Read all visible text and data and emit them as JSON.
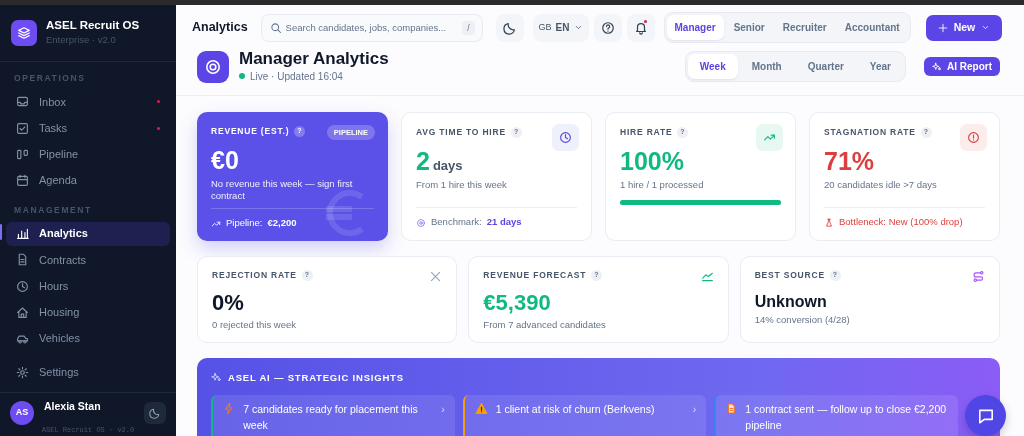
{
  "sidebar": {
    "brand": {
      "name": "ASEL Recruit OS",
      "subtitle": "Enterprise · v2.0"
    },
    "sections": [
      {
        "title": "OPERATIONS",
        "items": [
          {
            "label": "Inbox",
            "selected": false,
            "dot": true
          },
          {
            "label": "Tasks",
            "selected": false,
            "dot": true
          },
          {
            "label": "Pipeline",
            "selected": false,
            "dot": false
          },
          {
            "label": "Agenda",
            "selected": false,
            "dot": false
          }
        ]
      },
      {
        "title": "MANAGEMENT",
        "items": [
          {
            "label": "Analytics",
            "selected": true,
            "dot": false
          },
          {
            "label": "Contracts",
            "selected": false,
            "dot": false
          },
          {
            "label": "Hours",
            "selected": false,
            "dot": false
          },
          {
            "label": "Housing",
            "selected": false,
            "dot": false
          },
          {
            "label": "Vehicles",
            "selected": false,
            "dot": false
          }
        ]
      }
    ],
    "settings": {
      "label": "Settings",
      "selected": false
    },
    "user": {
      "initials": "AS",
      "name": "Alexia Stan"
    },
    "footer": "ASEL Recruit OS · v2.0"
  },
  "topbar": {
    "title": "Analytics",
    "search": {
      "placeholder": "Search candidates, jobs, companies...",
      "shortcut": "/"
    },
    "language": {
      "flag": "GB",
      "code": "EN"
    },
    "notifications_unread": true,
    "roles": [
      {
        "label": "Manager",
        "selected": true
      },
      {
        "label": "Senior",
        "selected": false
      },
      {
        "label": "Recruiter",
        "selected": false
      },
      {
        "label": "Accountant",
        "selected": false
      }
    ],
    "new_button": "New"
  },
  "page": {
    "title": "Manager Analytics",
    "status": "Live · Updated 16:04",
    "periods": [
      {
        "label": "Week",
        "selected": true
      },
      {
        "label": "Month",
        "selected": false
      },
      {
        "label": "Quarter",
        "selected": false
      },
      {
        "label": "Year",
        "selected": false
      }
    ],
    "ai_button": "AI Report"
  },
  "kpis": [
    {
      "kind": "featured",
      "title": "REVENUE (EST.)",
      "help": "?",
      "tag": "PIPELINE",
      "value": "€0",
      "subtitle": "No revenue this week — sign first contract",
      "footer_label": "Pipeline:",
      "footer_value": "€2,200",
      "color": "#ffffff"
    },
    {
      "kind": "icon",
      "title": "AVG TIME TO HIRE",
      "help": "?",
      "value": "2",
      "unit": "days",
      "subtitle": "From 1 hire this week",
      "footer_label": "Benchmark:",
      "footer_value": "21 days",
      "color": "#10b981"
    },
    {
      "kind": "progress",
      "title": "HIRE RATE",
      "help": "?",
      "value": "100%",
      "subtitle": "1 hire / 1 processed",
      "level": 1.0,
      "color": "#10b981"
    },
    {
      "kind": "icon",
      "title": "STAGNATION RATE",
      "help": "?",
      "value": "71%",
      "subtitle": "20 candidates idle >7 days",
      "footer_label": "Bottleneck: New (100% drop)",
      "color": "#dc3f3f"
    }
  ],
  "metrics": [
    {
      "title": "REJECTION RATE",
      "help": "?",
      "value": "0%",
      "subtitle": "0 rejected this week",
      "color": "#0f172a"
    },
    {
      "title": "REVENUE FORECAST",
      "help": "?",
      "value": "€5,390",
      "subtitle": "From 7 advanced candidates",
      "color": "#10b981"
    },
    {
      "title": "BEST SOURCE",
      "help": "?",
      "value": "Unknown",
      "subtitle": "14% conversion (4/28)",
      "color": "#0f172a"
    }
  ],
  "insights": {
    "title": "ASEL AI — STRATEGIC INSIGHTS",
    "items": [
      {
        "text": "7 candidates ready for placement this week",
        "color": "#10b981",
        "arrow": "›"
      },
      {
        "text": "1 client at risk of churn (Berkvens)",
        "color": "#f59e0b",
        "arrow": "›"
      },
      {
        "text": "1 contract sent — follow up to close €2,200 pipeline",
        "color": "#3b82f6"
      }
    ]
  }
}
